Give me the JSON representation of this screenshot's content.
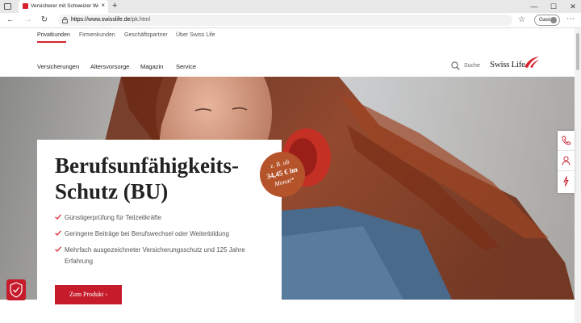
{
  "browser": {
    "tab_title": "Versicherer mit Schweizer Werte",
    "tab_close": "×",
    "new_tab": "+",
    "url_host": "https://www.swisslife.de",
    "url_path": "/pk.html",
    "profile_label": "Gast",
    "menu": "⋯"
  },
  "topnav": {
    "items": [
      "Privatkunden",
      "Firmenkunden",
      "Geschäftspartner",
      "Über Swiss Life"
    ],
    "active_index": 0
  },
  "mainnav": {
    "items": [
      "Versicherungen",
      "Altersvorsorge",
      "Magazin",
      "Service"
    ]
  },
  "search": {
    "label": "Suche"
  },
  "logo": {
    "text": "Swiss Life"
  },
  "hero": {
    "title": "Berufsunfähigkeits-\nSchutz (BU)",
    "bullets": [
      "Günstigerprüfung für Teilzeitkräfte",
      "Geringere Beiträge bei Berufswechsel oder Weiterbildung",
      "Mehrfach ausgezeichneter Versicherungsschutz und 125 Jahre Erfahrung"
    ],
    "cta": "Zum Produkt",
    "cta_arrow": "›"
  },
  "badge": {
    "line1": "z. B. ab",
    "line2": "34,45 € im",
    "line3": "Monat*"
  },
  "colors": {
    "brand_red": "#d8222d",
    "cta_red": "#c51b2b",
    "badge_orange": "#b5532a"
  },
  "icons": {
    "side_actions": [
      "phone-icon",
      "person-icon",
      "bolt-icon"
    ]
  }
}
